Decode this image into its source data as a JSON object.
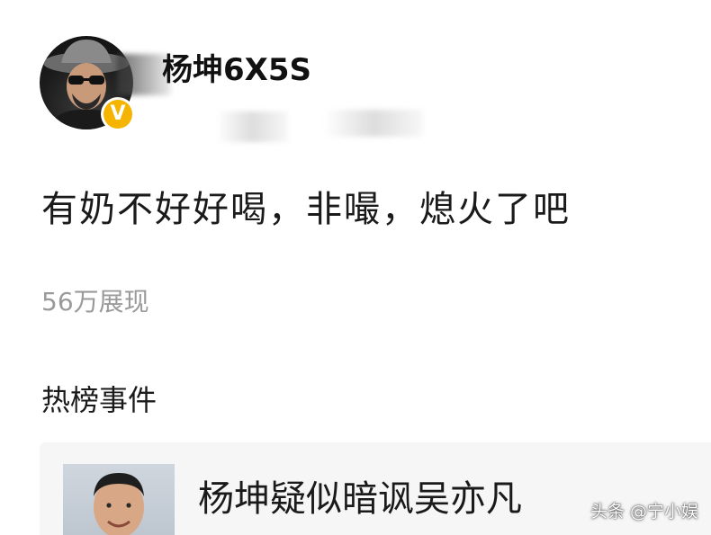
{
  "post": {
    "author": "杨坤6X5S",
    "verified_badge": "V",
    "text": "有奶不好好喝，非嘬，熄火了吧",
    "views": "56万展现"
  },
  "hot_event": {
    "section_title": "热榜事件",
    "title": "杨坤疑似暗讽吴亦凡"
  },
  "watermark": "头条 @宁小娱",
  "colors": {
    "verified": "#f5b400",
    "views_text": "#9a9a9a",
    "card_background": "#f6f6f6"
  }
}
